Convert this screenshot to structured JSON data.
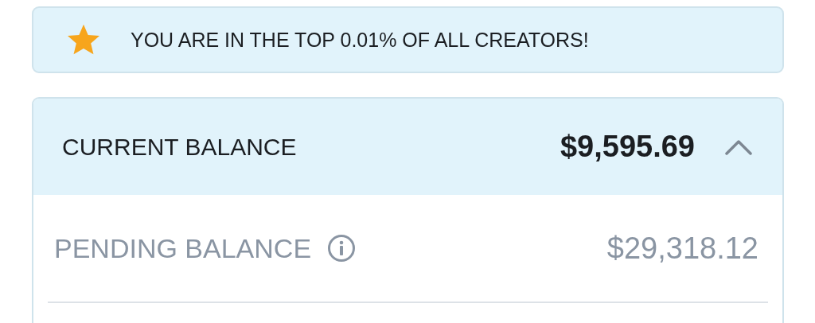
{
  "banner": {
    "text": "YOU ARE IN THE TOP 0.01% OF ALL CREATORS!"
  },
  "balance": {
    "label": "CURRENT BALANCE",
    "amount": "$9,595.69",
    "expanded": true
  },
  "details": [
    {
      "label": "PENDING BALANCE",
      "amount": "$29,318.12"
    }
  ]
}
